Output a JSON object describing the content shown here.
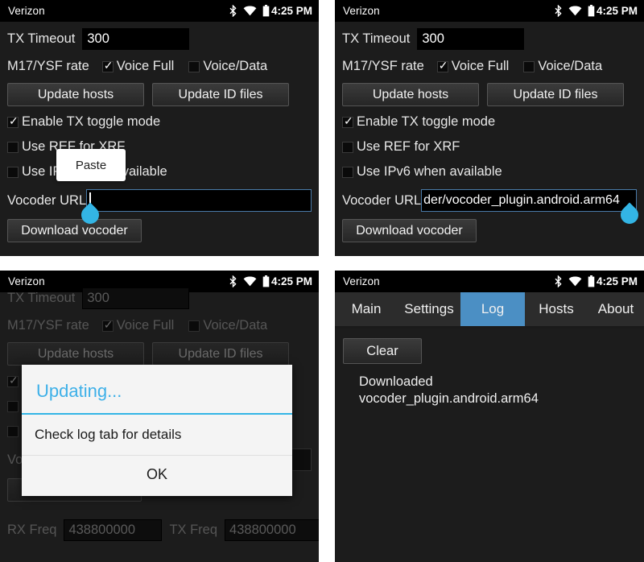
{
  "status_bar": {
    "carrier": "Verizon",
    "clock": "4:25 PM",
    "icons": [
      "bluetooth-icon",
      "wifi-icon",
      "battery-icon"
    ]
  },
  "settings": {
    "tx_timeout_label": "TX Timeout",
    "tx_timeout_value": "300",
    "rate_label": "M17/YSF rate",
    "voice_full_label": "Voice Full",
    "voice_full_checked": true,
    "voice_data_label": "Voice/Data",
    "voice_data_checked": false,
    "update_hosts_label": "Update hosts",
    "update_id_files_label": "Update ID files",
    "tx_toggle_label": "Enable TX toggle mode",
    "tx_toggle_checked": true,
    "use_ref_label": "Use REF for XRF",
    "use_ref_checked": false,
    "use_ipv6_label": "Use IPv6 when available",
    "use_ipv6_checked": false,
    "vocoder_url_label": "Vocoder URL",
    "vocoder_url_empty": "",
    "vocoder_url_filled": "der/vocoder_plugin.android.arm64",
    "download_vocoder_label": "Download vocoder",
    "rx_freq_label": "RX Freq",
    "rx_freq_value": "438800000",
    "tx_freq_label": "TX Freq",
    "tx_freq_value": "438800000"
  },
  "paste_bubble": {
    "label": "Paste"
  },
  "dialog": {
    "title": "Updating...",
    "message": "Check log tab for details",
    "ok_label": "OK",
    "accent_color": "#33b5e5"
  },
  "tabs": {
    "items": [
      {
        "label": "Main",
        "active": false
      },
      {
        "label": "Settings",
        "active": false
      },
      {
        "label": "Log",
        "active": true
      },
      {
        "label": "Hosts",
        "active": false
      },
      {
        "label": "About",
        "active": false
      }
    ],
    "active_color": "#4b8fc4"
  },
  "log": {
    "clear_label": "Clear",
    "entry": "Downloaded\nvocoder_plugin.android.arm64"
  }
}
